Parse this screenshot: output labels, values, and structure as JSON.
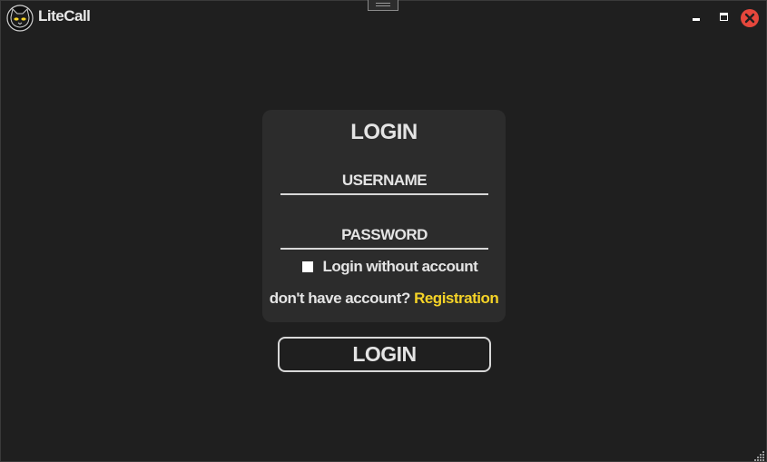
{
  "app": {
    "title": "LiteCall",
    "logo_icon": "cat-face-icon"
  },
  "window_controls": {
    "minimize_icon": "minimize-icon",
    "maximize_icon": "maximize-icon",
    "close_icon": "close-icon",
    "close_color": "#e5473c"
  },
  "login_card": {
    "title": "LOGIN",
    "username_placeholder": "USERNAME",
    "password_placeholder": "PASSWORD",
    "checkbox_label": "Login without account",
    "checkbox_checked": false,
    "no_account_text": "don't have account?",
    "registration_link": "Registration"
  },
  "login_button": {
    "label": "LOGIN"
  },
  "colors": {
    "background": "#1f1f1f",
    "card": "#2c2c2c",
    "link": "#f5d327"
  }
}
